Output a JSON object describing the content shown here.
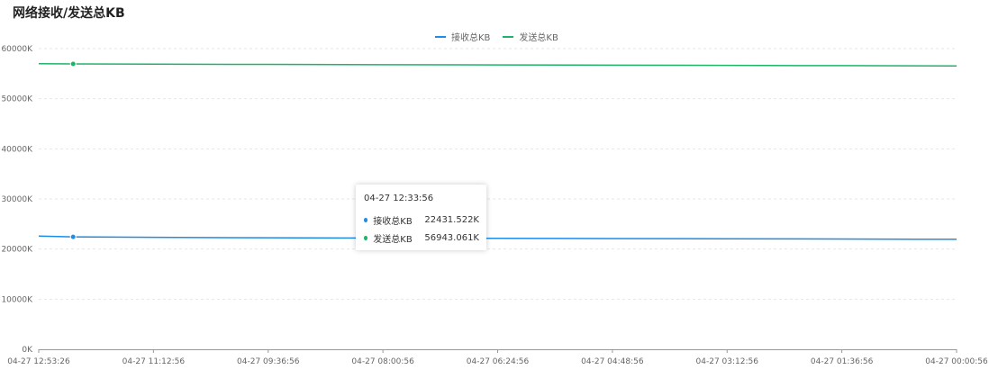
{
  "chart_data": {
    "type": "line",
    "title": "网络接收/发送总KB",
    "xlabel": "",
    "ylabel": "",
    "ylim": [
      0,
      60000
    ],
    "y_ticks": [
      "0K",
      "10000K",
      "20000K",
      "30000K",
      "40000K",
      "50000K",
      "60000K"
    ],
    "x_ticks": [
      "04-27 12:53:26",
      "04-27 11:12:56",
      "04-27 09:36:56",
      "04-27 08:00:56",
      "04-27 06:24:56",
      "04-27 04:48:56",
      "04-27 03:12:56",
      "04-27 01:36:56",
      "04-27 00:00:56"
    ],
    "grid": true,
    "legend_position": "top-center",
    "series": [
      {
        "name": "接收总KB",
        "color": "#1f8ce6",
        "x": [
          0,
          0.3,
          1,
          2,
          3,
          4,
          5,
          6,
          7,
          8
        ],
        "values": [
          22600,
          22431.522,
          22350,
          22250,
          22200,
          22150,
          22100,
          22050,
          22000,
          21950
        ]
      },
      {
        "name": "发送总KB",
        "color": "#1fb36a",
        "x": [
          0,
          0.3,
          1,
          2,
          3,
          4,
          5,
          6,
          7,
          8
        ],
        "values": [
          57000,
          56943.061,
          56900,
          56850,
          56800,
          56750,
          56700,
          56650,
          56600,
          56550
        ]
      }
    ]
  },
  "tooltip": {
    "time": "04-27 12:33:56",
    "rows": [
      {
        "name": "接收总KB",
        "value": "22431.522K",
        "color": "#1f8ce6"
      },
      {
        "name": "发送总KB",
        "value": "56943.061K",
        "color": "#1fb36a"
      }
    ]
  }
}
